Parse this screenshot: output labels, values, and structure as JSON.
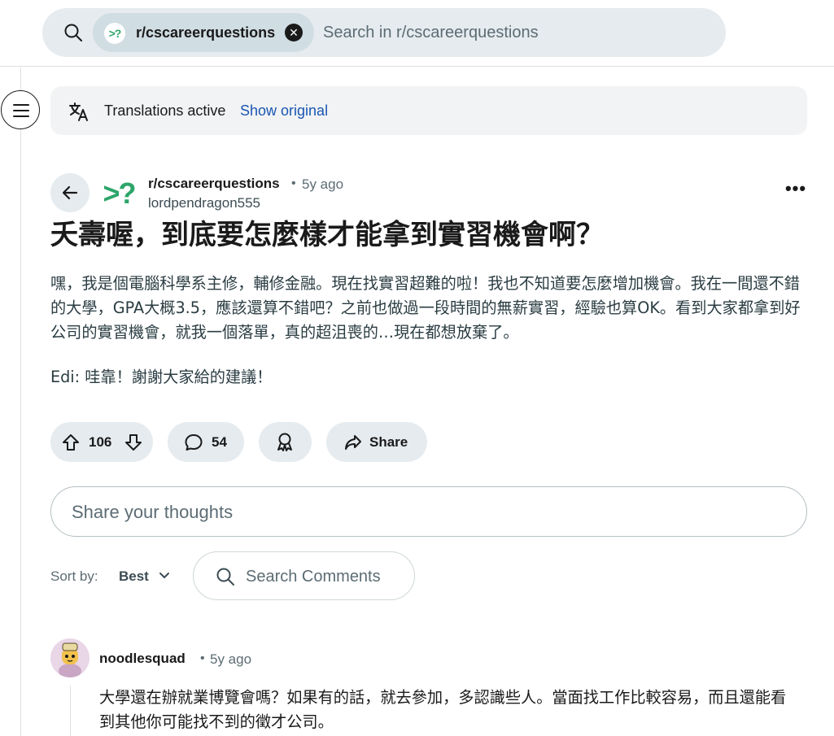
{
  "search": {
    "chip_label": "r/cscareerquestions",
    "chip_avatar_text": ">?",
    "placeholder": "Search in r/cscareerquestions"
  },
  "translation": {
    "label": "Translations active",
    "link": "Show original"
  },
  "post": {
    "avatar_text": ">?",
    "subreddit": "r/cscareerquestions",
    "separator": "•",
    "age": "5y ago",
    "author": "lordpendragon555",
    "more": "•••",
    "title": "夭壽喔，到底要怎麼樣才能拿到實習機會啊？",
    "body": "嘿，我是個電腦科學系主修，輔修金融。現在找實習超難的啦！我也不知道要怎麼增加機會。我在一間還不錯的大學，GPA大概3.5，應該還算不錯吧？之前也做過一段時間的無薪實習，經驗也算OK。看到大家都拿到好公司的實習機會，就我一個落單，真的超沮喪的…現在都想放棄了。",
    "edit": "Edi: 哇靠！謝謝大家給的建議！"
  },
  "actions": {
    "votes": "106",
    "comments": "54",
    "share": "Share"
  },
  "composer": {
    "placeholder": "Share your thoughts"
  },
  "sort": {
    "label": "Sort by:",
    "value": "Best",
    "search_placeholder": "Search Comments"
  },
  "comment": {
    "author": "noodlesquad",
    "separator": "•",
    "age": "5y ago",
    "body": "大學還在辦就業博覽會嗎？如果有的話，就去參加，多認識些人。當面找工作比較容易，而且還能看到其他你可能找不到的徵才公司。"
  },
  "colors": {
    "accent_link": "#1a55b3",
    "pill_bg": "#e5ebee",
    "subreddit_green": "#2ea56a"
  }
}
